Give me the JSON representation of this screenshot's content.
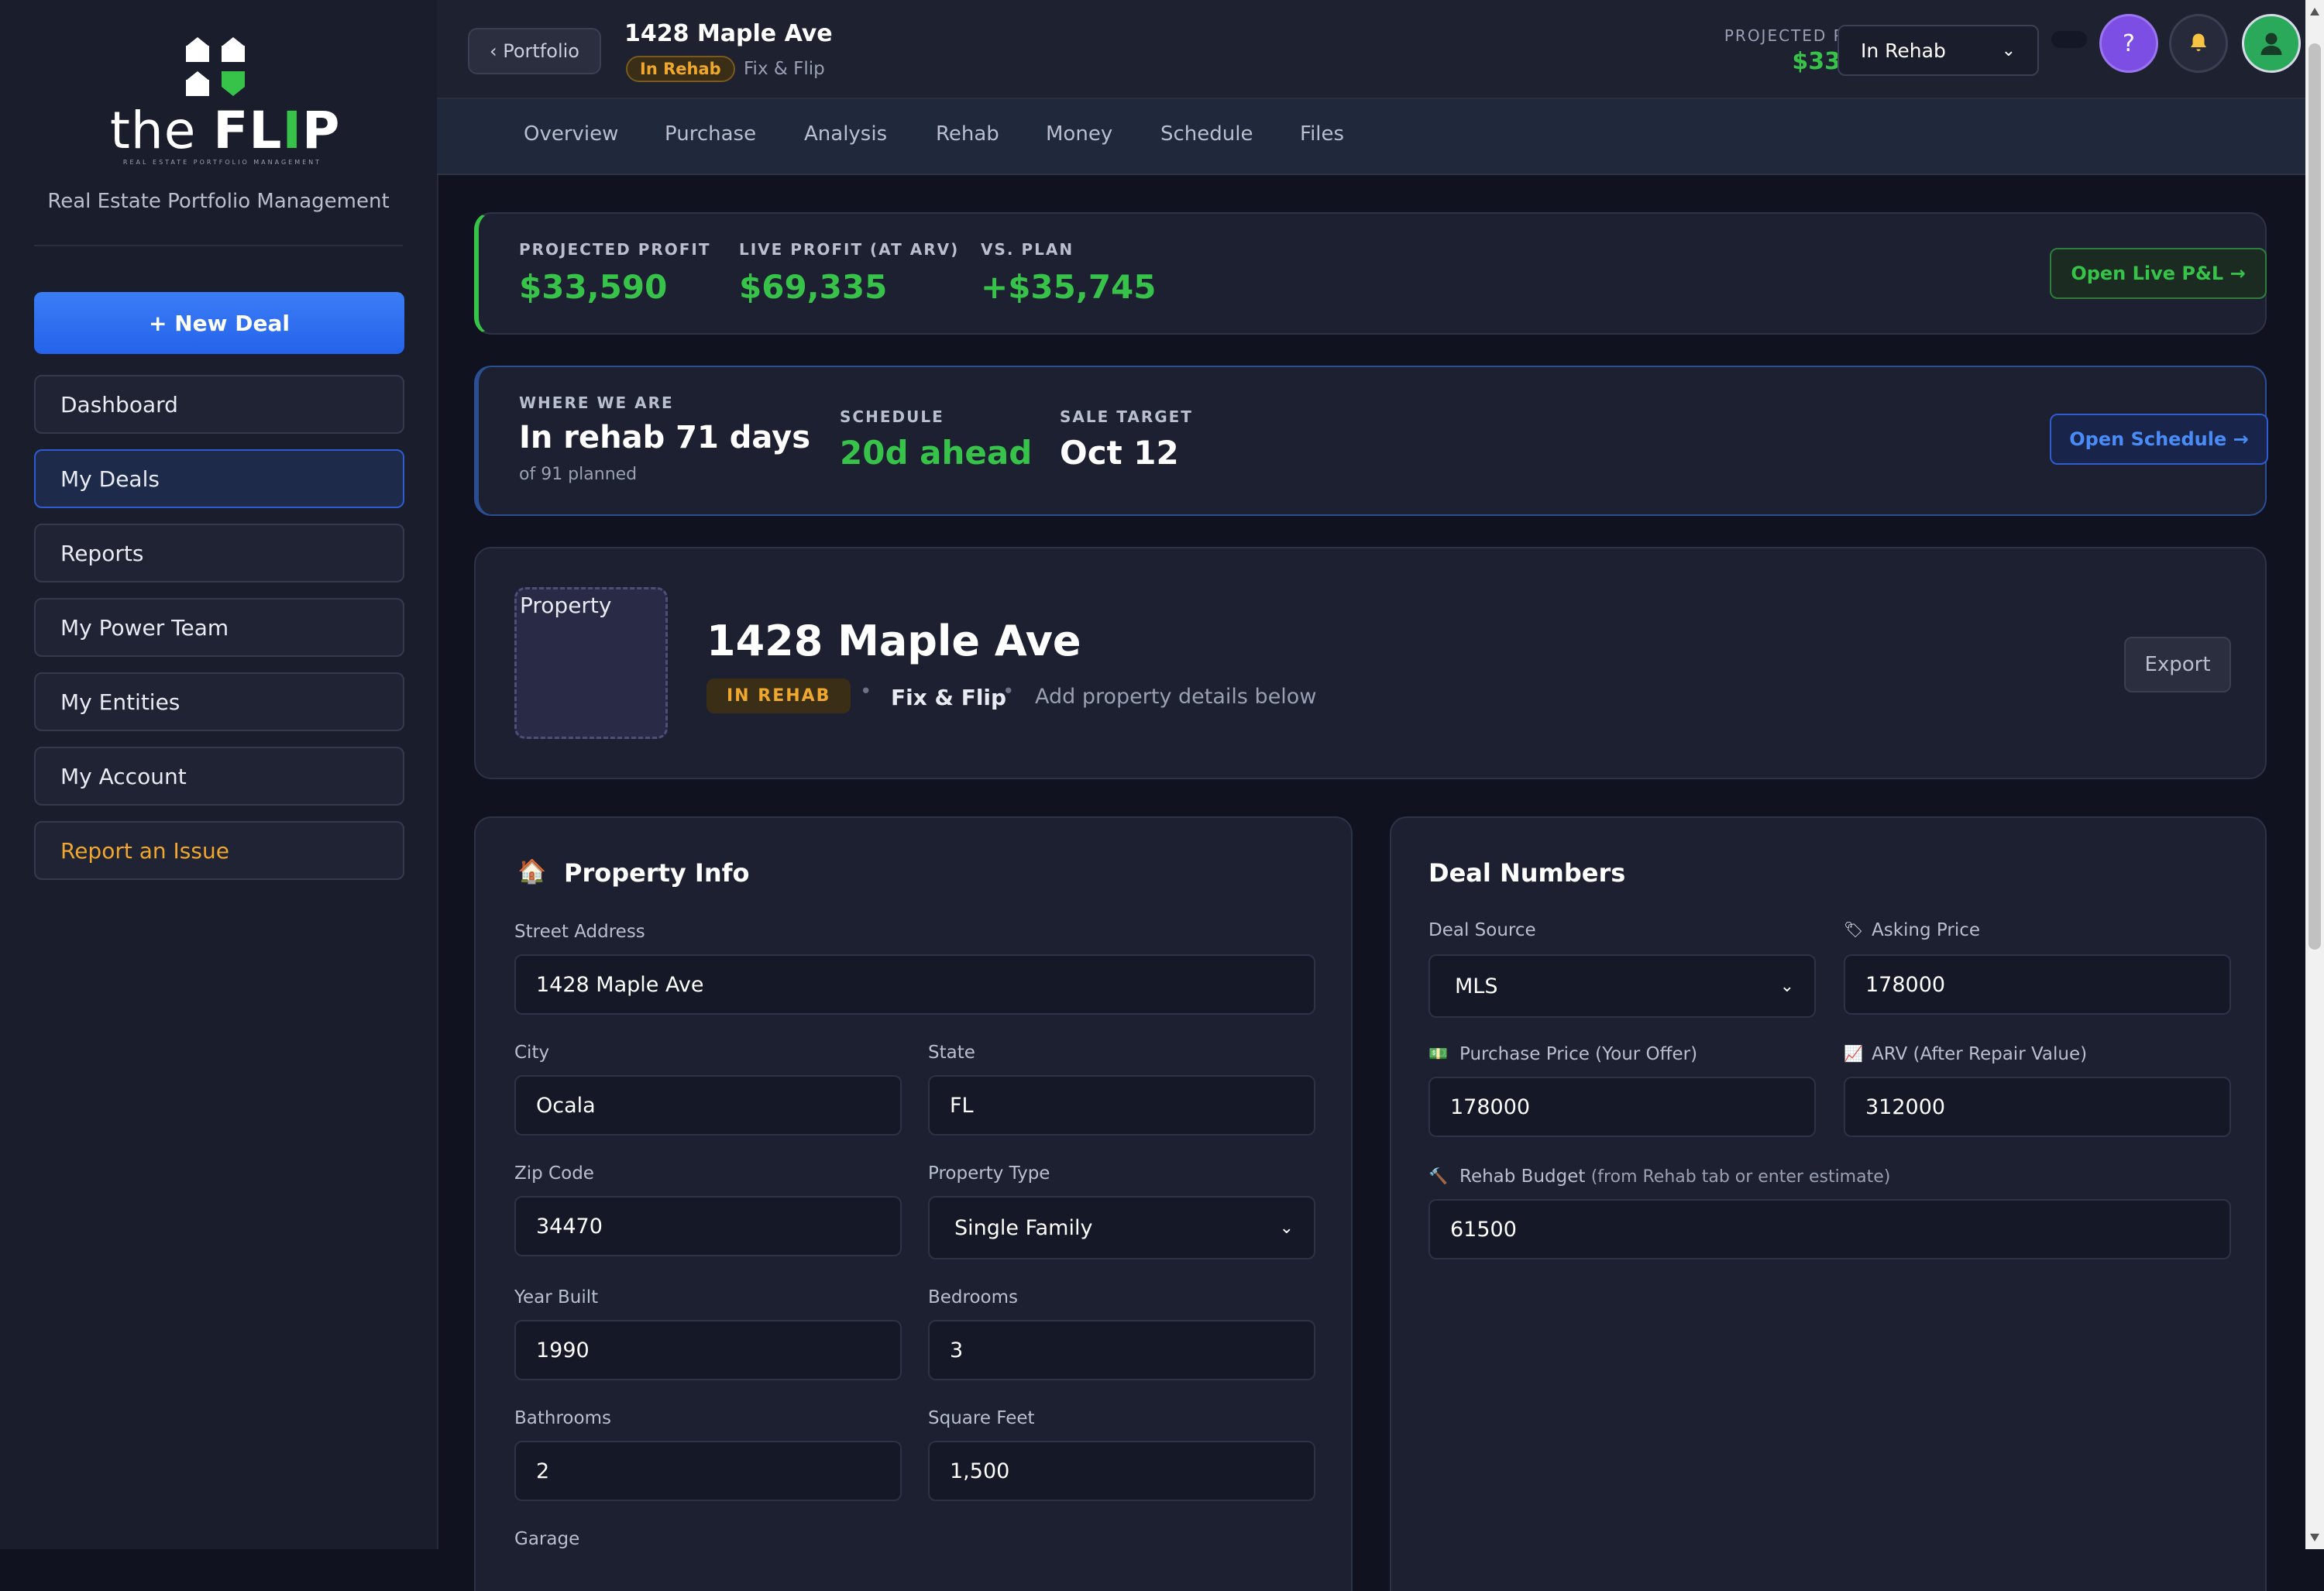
{
  "brand": {
    "logo_word_plain": "the ",
    "logo_word_bold_1": "FL",
    "logo_word_bold_i": "I",
    "logo_word_bold_2": "P",
    "logo_tagline": "REAL ESTATE PORTFOLIO MANAGEMENT",
    "tagline": "Real Estate Portfolio Management"
  },
  "sidebar": {
    "new_deal": "+ New Deal",
    "items": [
      {
        "label": "Dashboard"
      },
      {
        "label": "My Deals"
      },
      {
        "label": "Reports"
      },
      {
        "label": "My Power Team"
      },
      {
        "label": "My Entities"
      },
      {
        "label": "My Account"
      },
      {
        "label": "Report an Issue"
      }
    ]
  },
  "header": {
    "back": "‹ Portfolio",
    "title": "1428 Maple Ave",
    "badge": "In Rehab",
    "type": "Fix & Flip",
    "pp_label": "PROJECTED PROFIT",
    "pp_value": "$33,590",
    "status_value": "In Rehab",
    "help_icon": "?"
  },
  "tabs": [
    "Overview",
    "Purchase",
    "Analysis",
    "Rehab",
    "Money",
    "Schedule",
    "Files"
  ],
  "profit_card": {
    "k1_label": "PROJECTED PROFIT",
    "k1_value": "$33,590",
    "k2_label": "LIVE PROFIT (AT ARV)",
    "k2_value": "$69,335",
    "k3_label": "VS. PLAN",
    "k3_value": "+$35,745",
    "button": "Open Live P&L →"
  },
  "schedule_card": {
    "where_label": "WHERE WE ARE",
    "where_value": "In rehab 71 days",
    "where_sub": "of 91 planned",
    "sched_label": "SCHEDULE",
    "sched_value": "20d ahead",
    "sale_label": "SALE TARGET",
    "sale_value": "Oct 12",
    "button": "Open Schedule →"
  },
  "property_header": {
    "img_alt": "Property",
    "title": "1428 Maple Ave",
    "badge": "IN REHAB",
    "type": "Fix & Flip",
    "hint": "Add property details below",
    "export": "Export"
  },
  "property_info": {
    "title": "Property Info",
    "street_label": "Street Address",
    "street": "1428 Maple Ave",
    "city_label": "City",
    "city": "Ocala",
    "state_label": "State",
    "state": "FL",
    "zip_label": "Zip Code",
    "zip": "34470",
    "ptype_label": "Property Type",
    "ptype": "Single Family",
    "year_label": "Year Built",
    "year": "1990",
    "beds_label": "Bedrooms",
    "beds": "3",
    "baths_label": "Bathrooms",
    "baths": "2",
    "sqft_label": "Square Feet",
    "sqft": "1,500",
    "garage_label": "Garage"
  },
  "deal_numbers": {
    "title": "Deal Numbers",
    "source_label": "Deal Source",
    "source": "MLS",
    "asking_label": "Asking Price",
    "asking": "178000",
    "purchase_label": "Purchase Price (Your Offer)",
    "purchase": "178000",
    "arv_label": "ARV (After Repair Value)",
    "arv": "312000",
    "rehab_label": "Rehab Budget",
    "rehab_hint": "(from Rehab tab or enter estimate)",
    "rehab": "61500"
  },
  "colors": {
    "accent_green": "#37c24a",
    "accent_blue": "#3b7df5",
    "warning_orange": "#f0a72d",
    "bg": "#10131f"
  }
}
